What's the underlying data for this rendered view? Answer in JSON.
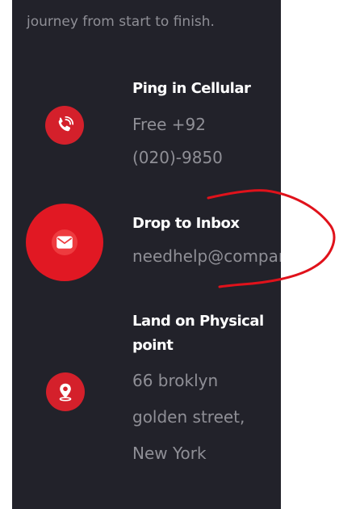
{
  "intro_text": "journey from start to finish.",
  "contacts": [
    {
      "title": "Ping in Cellular",
      "lines": [
        "Free +92",
        "(020)-9850"
      ],
      "icon": "phone-icon"
    },
    {
      "title": "Drop to Inbox",
      "lines": [
        "needhelp@company.com"
      ],
      "icon": "mail-icon"
    },
    {
      "title_lines": [
        "Land on Physical",
        "point"
      ],
      "lines": [
        "66 broklyn",
        "golden street,",
        "New York"
      ],
      "icon": "location-pin-icon"
    }
  ],
  "colors": {
    "panel_bg": "#22222a",
    "accent_red": "#e11823",
    "muted_text": "#8f8f96",
    "annotation": "#e0121b"
  }
}
